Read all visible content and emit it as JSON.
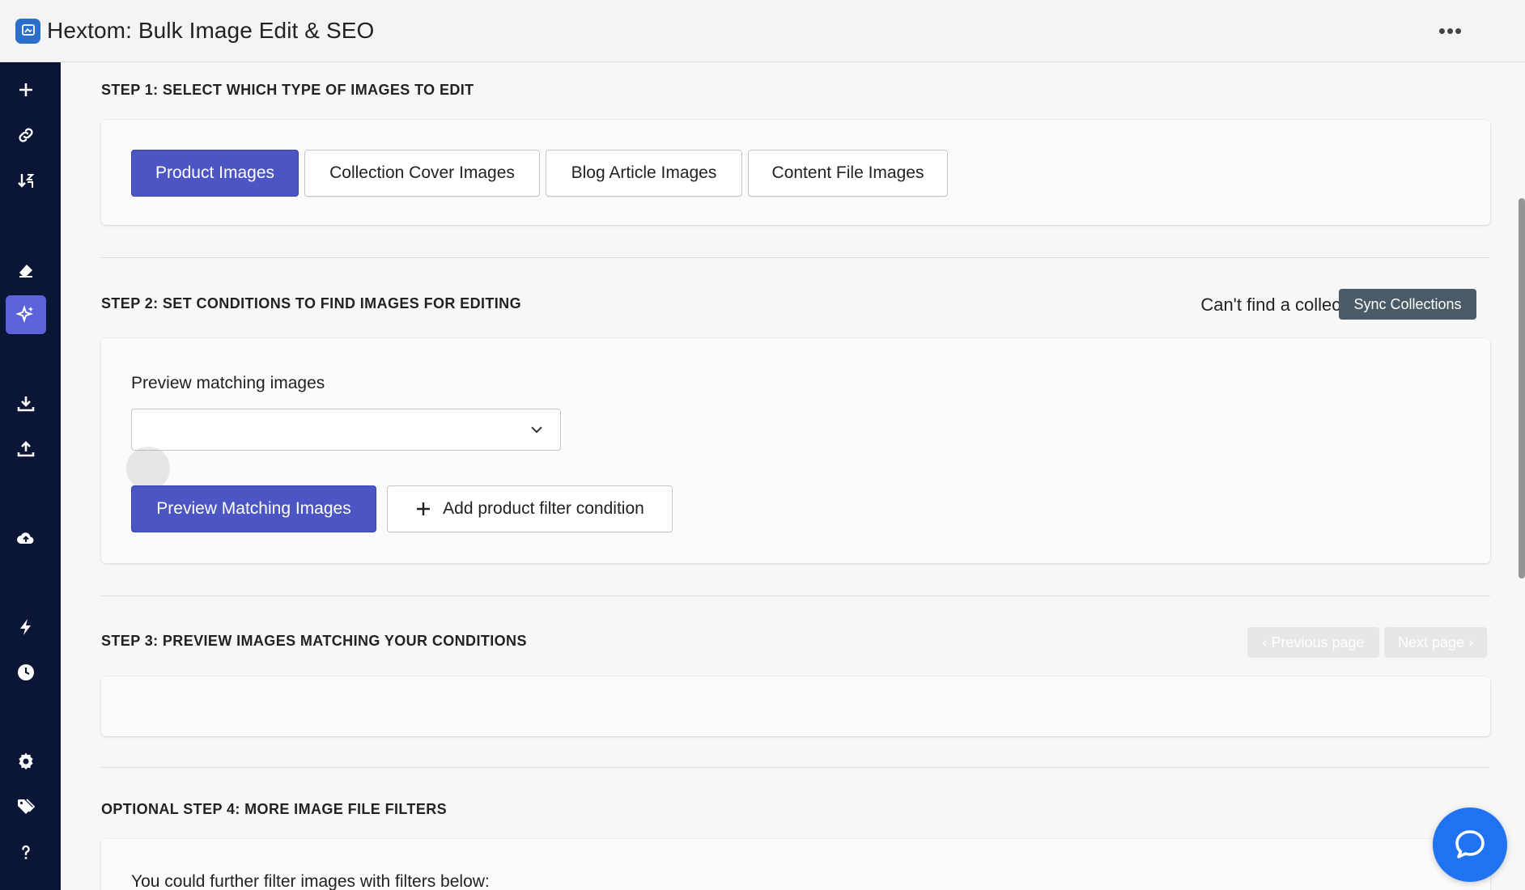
{
  "app": {
    "title": "Hextom: Bulk Image Edit & SEO",
    "more_label": "•••"
  },
  "sidebar": {
    "items": [
      {
        "icon": "plus-icon"
      },
      {
        "icon": "link-icon"
      },
      {
        "icon": "sort-icon"
      },
      {
        "icon": "eraser-icon"
      },
      {
        "icon": "sparkle-icon",
        "active": true
      },
      {
        "icon": "download-icon"
      },
      {
        "icon": "upload-icon"
      },
      {
        "icon": "cloud-upload-icon"
      },
      {
        "icon": "bolt-icon"
      },
      {
        "icon": "clock-icon"
      },
      {
        "icon": "gear-icon"
      },
      {
        "icon": "tag-icon"
      },
      {
        "icon": "help-icon"
      }
    ]
  },
  "step1": {
    "title": "STEP 1: SELECT WHICH TYPE OF IMAGES TO EDIT",
    "types": [
      "Product Images",
      "Collection Cover Images",
      "Blog Article Images",
      "Content File Images"
    ],
    "selected": "Product Images"
  },
  "step2": {
    "title": "STEP 2: SET CONDITIONS TO FIND IMAGES FOR EDITING",
    "sync_prompt": "Can't find a collection?",
    "sync_button": "Sync Collections",
    "preview_label": "Preview matching images",
    "select_value": "",
    "preview_button": "Preview Matching Images",
    "add_filter_button": "Add product filter condition"
  },
  "step3": {
    "title": "STEP 3: PREVIEW IMAGES MATCHING YOUR CONDITIONS",
    "prev_page": "Previous page",
    "next_page": "Next page"
  },
  "step4": {
    "title": "OPTIONAL STEP 4: MORE IMAGE FILE FILTERS",
    "description": "You could further filter images with filters below:"
  },
  "colors": {
    "primary": "#4b55c3",
    "sidebar": "#0b1536",
    "active": "#5a63d8",
    "help": "#1f73f0"
  }
}
